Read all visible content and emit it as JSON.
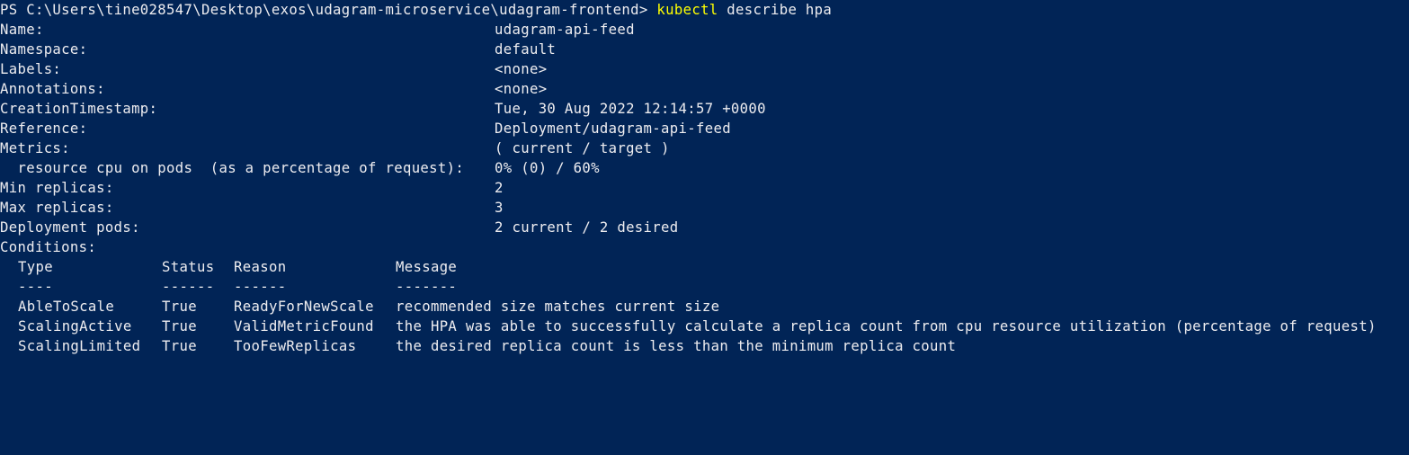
{
  "prompt": {
    "path": "PS C:\\Users\\tine028547\\Desktop\\exos\\udagram-microservice\\udagram-frontend> ",
    "command": "kubectl",
    "args": " describe hpa"
  },
  "describe": {
    "name_label": "Name:",
    "name_value": "udagram-api-feed",
    "namespace_label": "Namespace:",
    "namespace_value": "default",
    "labels_label": "Labels:",
    "labels_value": "<none>",
    "annotations_label": "Annotations:",
    "annotations_value": "<none>",
    "creation_label": "CreationTimestamp:",
    "creation_value": "Tue, 30 Aug 2022 12:14:57 +0000",
    "reference_label": "Reference:",
    "reference_value": "Deployment/udagram-api-feed",
    "metrics_label": "Metrics:",
    "metrics_value": "( current / target )",
    "resource_label": "  resource cpu on pods  (as a percentage of request):",
    "resource_value": "0% (0) / 60%",
    "min_label": "Min replicas:",
    "min_value": "2",
    "max_label": "Max replicas:",
    "max_value": "3",
    "pods_label": "Deployment pods:",
    "pods_value": "2 current / 2 desired",
    "conditions_label": "Conditions:"
  },
  "conditions": {
    "headers": [
      "Type",
      "Status",
      "Reason",
      "Message"
    ],
    "dashes": [
      "----",
      "------",
      "------",
      "-------"
    ],
    "rows": [
      [
        "AbleToScale",
        "True",
        "ReadyForNewScale",
        "recommended size matches current size"
      ],
      [
        "ScalingActive",
        "True",
        "ValidMetricFound",
        "the HPA was able to successfully calculate a replica count from cpu resource utilization (percentage of request)"
      ],
      [
        "ScalingLimited",
        "True",
        "TooFewReplicas",
        "the desired replica count is less than the minimum replica count"
      ]
    ]
  },
  "colors": {
    "background": "#012456",
    "text": "#eeedf0",
    "command": "#ffff00"
  }
}
